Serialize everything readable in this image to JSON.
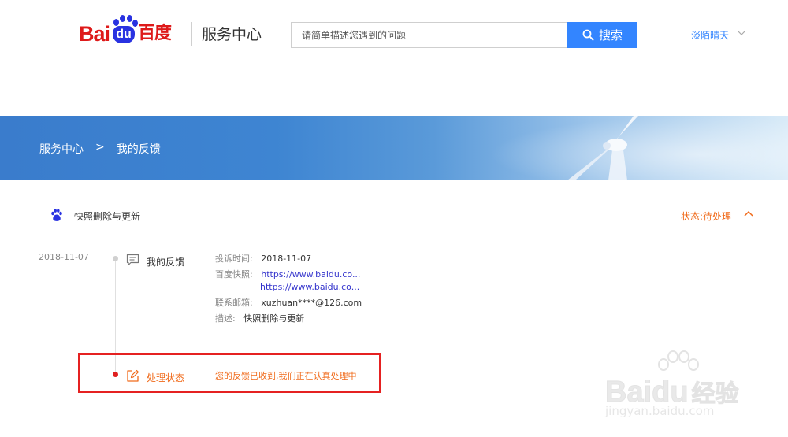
{
  "header": {
    "logo_bai": "Bai",
    "logo_du": "du",
    "logo_cn": "百度",
    "service_title": "服务中心",
    "search": {
      "placeholder": "请简单描述您遇到的问题",
      "button_label": "搜索"
    },
    "user_name": "淡陌晴天"
  },
  "banner": {
    "breadcrumb": [
      "服务中心",
      ">",
      "我的反馈"
    ]
  },
  "feedback": {
    "title": "快照删除与更新",
    "status": "状态:待处理",
    "date": "2018-11-07",
    "step1": {
      "label": "我的反馈",
      "fields": {
        "time_label": "投诉时间:",
        "time_value": "2018-11-07",
        "snapshot_label": "百度快照:",
        "snapshot_url_1": "https://www.baidu.co...",
        "snapshot_url_2": "https://www.baidu.co...",
        "email_label": "联系邮箱:",
        "email_value": "xuzhuan****@126.com",
        "desc_label": "描述:",
        "desc_value": "快照删除与更新"
      }
    },
    "step2": {
      "label": "处理状态",
      "text": "您的反馈已收到,我们正在认真处理中"
    }
  },
  "watermark": {
    "brand": "Baidu",
    "cn": "经验",
    "url": "jingyan.baidu.com"
  },
  "colors": {
    "brand_red": "#de1a1a",
    "brand_blue": "#2932e1",
    "accent_blue": "#3385ff",
    "status_orange": "#f06a1a",
    "highlight_red": "#e52121"
  }
}
